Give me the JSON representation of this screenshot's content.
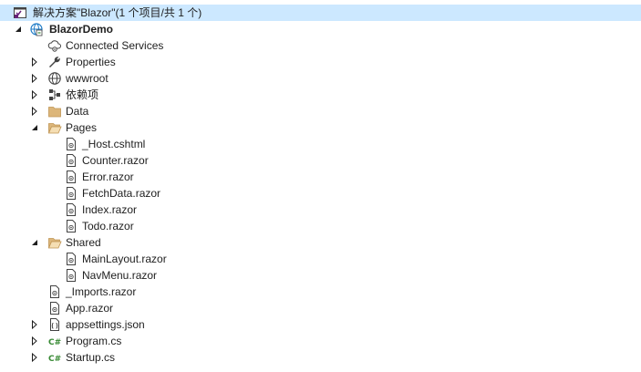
{
  "solution": {
    "label": "解决方案\"Blazor\"(1 个项目/共 1 个)",
    "icon": "solution-icon"
  },
  "project": {
    "label": "BlazorDemo",
    "icon": "web-project-icon",
    "expanded": true
  },
  "items": {
    "connected_services": "Connected Services",
    "properties": "Properties",
    "wwwroot": "wwwroot",
    "dependencies": "依赖项",
    "data": "Data",
    "pages": "Pages",
    "pages_files": [
      "_Host.cshtml",
      "Counter.razor",
      "Error.razor",
      "FetchData.razor",
      "Index.razor",
      "Todo.razor"
    ],
    "shared": "Shared",
    "shared_files": [
      "MainLayout.razor",
      "NavMenu.razor"
    ],
    "imports": "_Imports.razor",
    "app": "App.razor",
    "appsettings": "appsettings.json",
    "program": "Program.cs",
    "startup": "Startup.cs"
  },
  "colors": {
    "selection": "#cce8ff",
    "folder": "#dcb67a",
    "csharp": "#388a34",
    "vs_purple": "#68217a"
  }
}
